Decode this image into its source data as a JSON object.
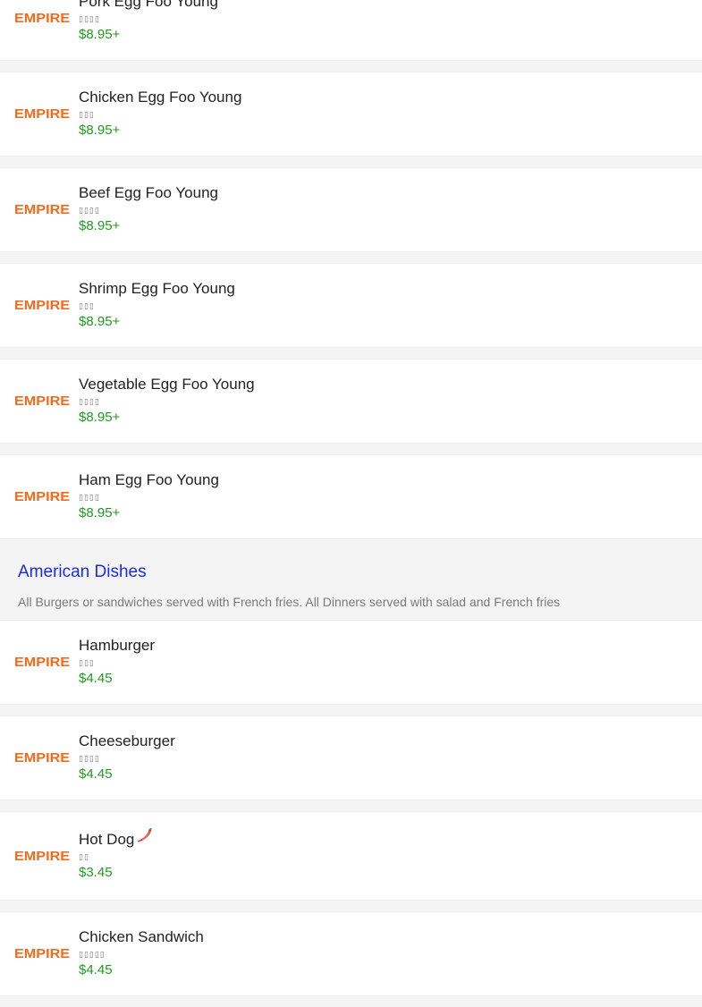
{
  "logo_text": "EMPIRE",
  "colors": {
    "logo": "#f26b1d",
    "price": "#1f9a1f",
    "section_title": "#1d2be0"
  },
  "groups": [
    {
      "items": [
        {
          "name": "Pork Egg Foo Young",
          "cn": "▯▯▯▯",
          "price": "$8.95+",
          "spicy": false
        },
        {
          "name": "Chicken Egg Foo Young",
          "cn": "▯▯▯",
          "price": "$8.95+",
          "spicy": false
        },
        {
          "name": "Beef Egg Foo Young",
          "cn": "▯▯▯▯",
          "price": "$8.95+",
          "spicy": false
        },
        {
          "name": "Shrimp Egg Foo Young",
          "cn": "▯▯▯",
          "price": "$8.95+",
          "spicy": false
        },
        {
          "name": "Vegetable Egg Foo Young",
          "cn": "▯▯▯▯",
          "price": "$8.95+",
          "spicy": false
        },
        {
          "name": "Ham Egg Foo Young",
          "cn": "▯▯▯▯",
          "price": "$8.95+",
          "spicy": false
        }
      ]
    },
    {
      "section": {
        "title": "American Dishes",
        "description": "All Burgers or sandwiches served with French fries. All Dinners served with salad and French fries"
      },
      "items": [
        {
          "name": "Hamburger",
          "cn": "▯▯▯",
          "price": "$4.45",
          "spicy": false
        },
        {
          "name": "Cheeseburger",
          "cn": "▯▯▯▯",
          "price": "$4.45",
          "spicy": false
        },
        {
          "name": "Hot Dog",
          "cn": "▯▯",
          "price": "$3.45",
          "spicy": true,
          "spicy_icon": "chili-pepper-icon"
        },
        {
          "name": "Chicken Sandwich",
          "cn": "▯▯▯▯▯",
          "price": "$4.45",
          "spicy": false
        }
      ]
    }
  ]
}
